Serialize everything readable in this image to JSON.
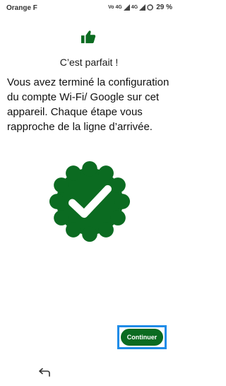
{
  "status_bar": {
    "carrier": "Orange F",
    "volte": "Vo",
    "network_1": "4G",
    "network_2": "4G",
    "battery": "29 %"
  },
  "icons": {
    "top": "thumbs-up-icon",
    "badge": "check-badge-icon",
    "back": "back-arrow-icon"
  },
  "colors": {
    "brand_green": "#0b6b21",
    "highlight_blue": "#1f8ce8"
  },
  "main": {
    "title": "C’est parfait !",
    "message": "Vous avez terminé la configuration du compte Wi-Fi/ Google sur cet appareil. Chaque étape vous rapproche de la ligne d’arrivée."
  },
  "actions": {
    "continue_label": "Continuer"
  }
}
